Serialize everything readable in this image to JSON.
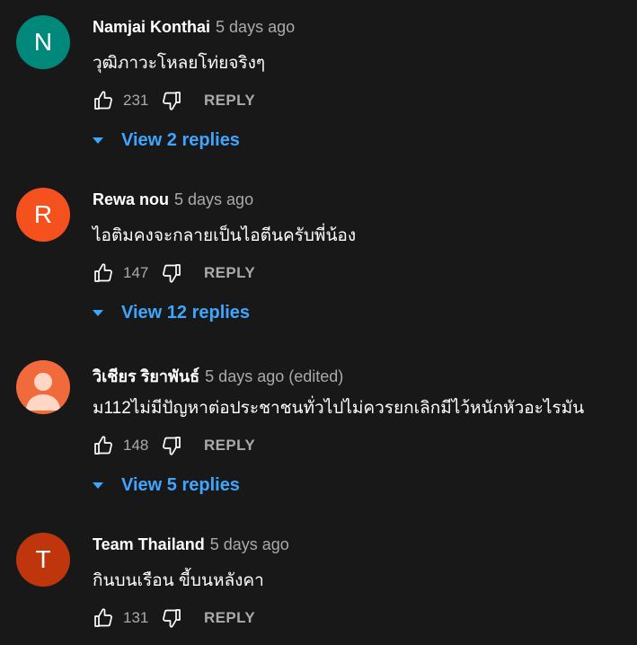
{
  "comments": [
    {
      "author": "Namjai Konthai",
      "time": "5 days ago",
      "text": "วุฒิภาวะโหลยโท่ยจริงๆ",
      "likes": "231",
      "reply_label": "REPLY",
      "view_replies": "View 2 replies",
      "avatar_letter": "N",
      "avatar_color": "#00897b"
    },
    {
      "author": "Rewa nou",
      "time": "5 days ago",
      "text": "ไอติมคงจะกลายเป็นไอตีนครับพี่น้อง",
      "likes": "147",
      "reply_label": "REPLY",
      "view_replies": "View 12 replies",
      "avatar_letter": "R",
      "avatar_color": "#f4511e"
    },
    {
      "author": "วิเชียร ริยาพันธ์",
      "time": "5 days ago (edited)",
      "text": "ม112ไม่มีปัญหาต่อประชาชนทั่วไปไม่ควรยกเลิกมีไว้หนักหัวอะไรมัน",
      "likes": "148",
      "reply_label": "REPLY",
      "view_replies": "View 5 replies",
      "avatar_icon": "default-person-icon",
      "avatar_color": "#f06a3c"
    },
    {
      "author": "Team Thailand",
      "time": "5 days ago",
      "text": "กินบนเรือน ขี้บนหลังคา",
      "likes": "131",
      "reply_label": "REPLY",
      "avatar_letter": "T",
      "avatar_color": "#bf360c"
    }
  ],
  "colors": {
    "background": "#181818",
    "link": "#3ea6ff",
    "secondary_text": "#aaaaaa"
  }
}
